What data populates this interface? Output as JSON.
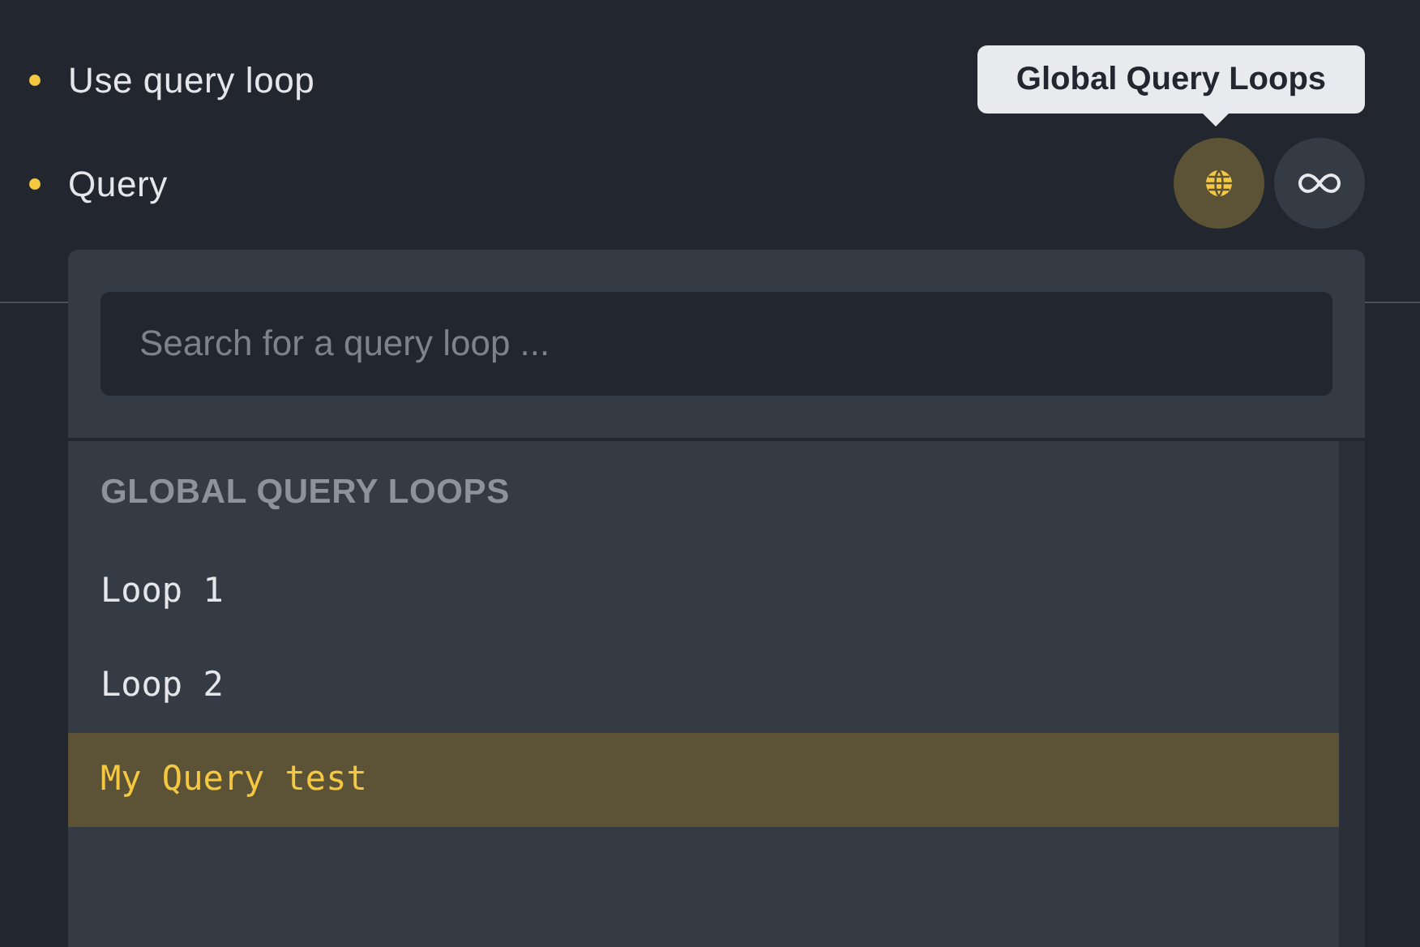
{
  "controls": [
    {
      "label": "Use query loop"
    },
    {
      "label": "Query"
    }
  ],
  "tooltip": {
    "text": "Global Query Loops"
  },
  "query_buttons": [
    {
      "kind": "globe",
      "selected": true
    },
    {
      "kind": "infinity",
      "selected": false
    }
  ],
  "dropdown": {
    "search": {
      "placeholder": "Search for a query loop ..."
    },
    "group_heading": "GLOBAL QUERY LOOPS",
    "items": [
      {
        "label": "Loop 1",
        "selected": false
      },
      {
        "label": "Loop 2",
        "selected": false
      },
      {
        "label": "My Query test",
        "selected": true
      }
    ]
  }
}
